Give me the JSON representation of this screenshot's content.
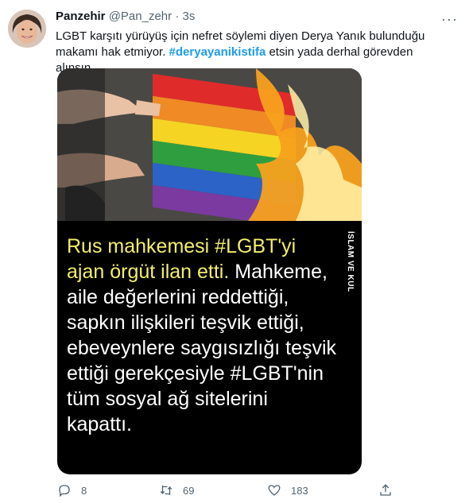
{
  "tweet": {
    "author_name": "Panzehir",
    "author_handle": "@Pan_zehr",
    "separator": "·",
    "time": "3s",
    "more_label": "···",
    "text_before_line1": "LGBT karşıtı yürüyüş için nefret söylemi diyen Derya Yanık  bulunduğu",
    "text_before_line2": "makamı hak etmiyor. ",
    "hashtag": "#deryayanikistifa",
    "text_after": " etsin yada derhal görevden alınsın.."
  },
  "media": {
    "side_text": "İSLAM VE KUL",
    "caption_line_yellow": "Rus mahkemesi #LGBT'yi ajan örgüt ilan etti.",
    "caption_line_white": "Mahkeme, aile değerlerini reddettiği, sapkın ilişkileri teşvik ettiği, ebeveynlere saygısızlığı teşvik ettiği gerekçesiyle #LGBT'nin tüm sosyal ağ sitelerini kapattı."
  },
  "actions": {
    "replies": "8",
    "retweets": "69",
    "likes": "183",
    "reply_icon": "reply-icon",
    "retweet_icon": "retweet-icon",
    "like_icon": "heart-icon",
    "share_icon": "share-icon"
  },
  "colors": {
    "hashtag": "#1d9bf0",
    "caption_yellow": "#f3ef6c",
    "secondary_text": "#536471"
  }
}
